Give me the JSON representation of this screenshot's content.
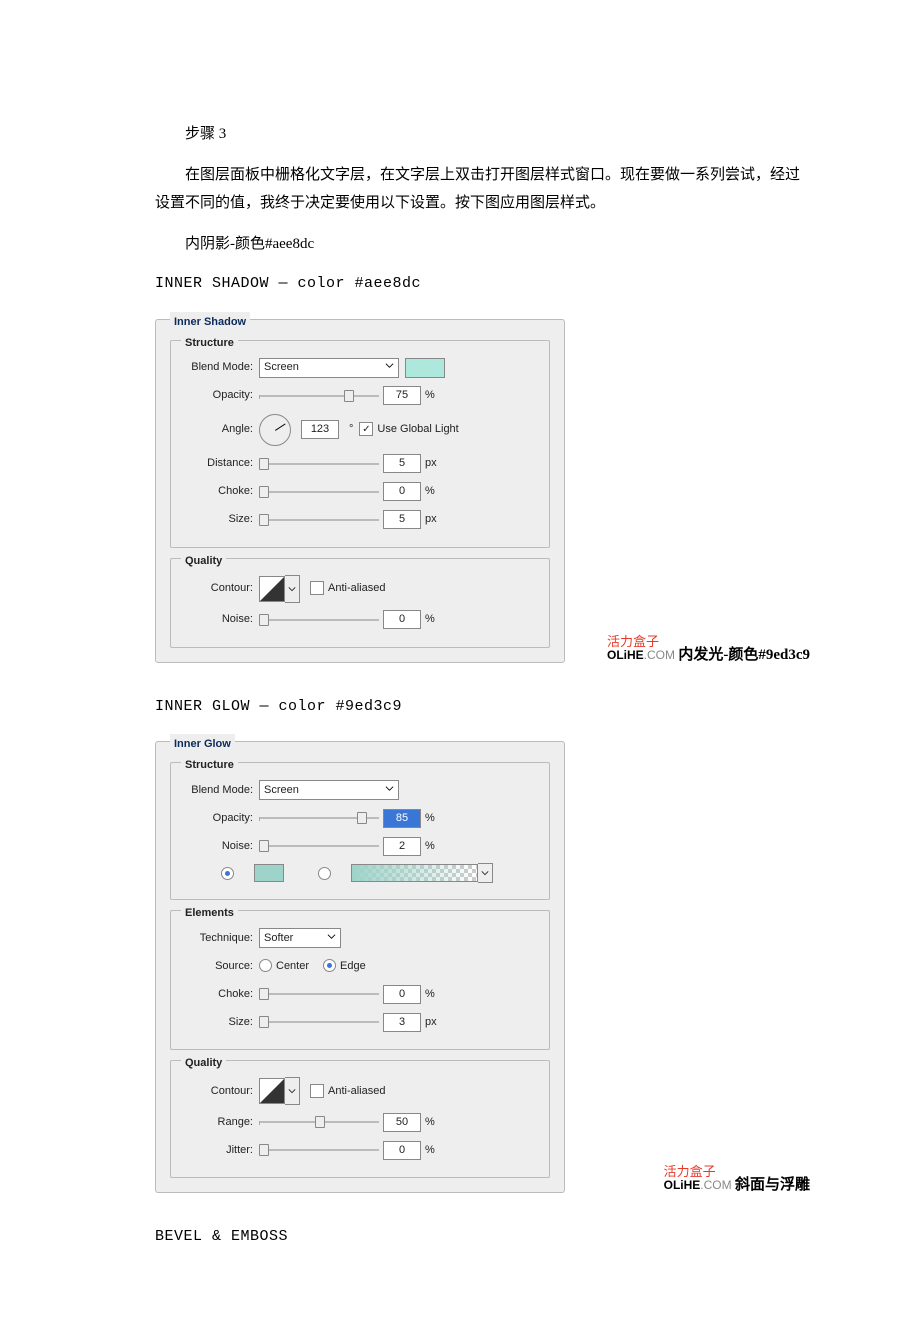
{
  "text": {
    "step": "步骤 3",
    "para1": "在图层面板中栅格化文字层，在文字层上双击打开图层样式窗口。现在要做一系列尝试，经过设置不同的值，我终于决定要使用以下设置。按下图应用图层样式。",
    "inner_shadow_cn": "内阴影-颜色#aee8dc",
    "inner_shadow_en": "INNER SHADOW — color #aee8dc",
    "inner_glow_cn": "内发光-颜色#9ed3c9",
    "inner_glow_en": "INNER GLOW — color #9ed3c9",
    "bevel_cn": "斜面与浮雕",
    "bevel_en": "BEVEL & EMBOSS"
  },
  "brand": {
    "top": "活力盒子",
    "bold": "OLiHE",
    "rest": ".COM"
  },
  "shadow": {
    "title": "Inner Shadow",
    "structure": {
      "legend": "Structure",
      "blend_mode_label": "Blend Mode:",
      "blend_mode_value": "Screen",
      "swatch": "#aee8dc",
      "opacity_label": "Opacity:",
      "opacity_value": "75",
      "opacity_unit": "%",
      "angle_label": "Angle:",
      "angle_value": "123",
      "angle_unit": "°",
      "use_global_label": "Use Global Light",
      "use_global_checked": "✓",
      "distance_label": "Distance:",
      "distance_value": "5",
      "distance_unit": "px",
      "choke_label": "Choke:",
      "choke_value": "0",
      "choke_unit": "%",
      "size_label": "Size:",
      "size_value": "5",
      "size_unit": "px"
    },
    "quality": {
      "legend": "Quality",
      "contour_label": "Contour:",
      "anti_label": "Anti-aliased",
      "noise_label": "Noise:",
      "noise_value": "0",
      "noise_unit": "%"
    }
  },
  "glow": {
    "title": "Inner Glow",
    "structure": {
      "legend": "Structure",
      "blend_mode_label": "Blend Mode:",
      "blend_mode_value": "Screen",
      "opacity_label": "Opacity:",
      "opacity_value": "85",
      "opacity_unit": "%",
      "noise_label": "Noise:",
      "noise_value": "2",
      "noise_unit": "%",
      "swatch": "#9ed3c9"
    },
    "elements": {
      "legend": "Elements",
      "technique_label": "Technique:",
      "technique_value": "Softer",
      "source_label": "Source:",
      "source_center": "Center",
      "source_edge": "Edge",
      "choke_label": "Choke:",
      "choke_value": "0",
      "choke_unit": "%",
      "size_label": "Size:",
      "size_value": "3",
      "size_unit": "px"
    },
    "quality": {
      "legend": "Quality",
      "contour_label": "Contour:",
      "anti_label": "Anti-aliased",
      "range_label": "Range:",
      "range_value": "50",
      "range_unit": "%",
      "jitter_label": "Jitter:",
      "jitter_value": "0",
      "jitter_unit": "%"
    }
  }
}
